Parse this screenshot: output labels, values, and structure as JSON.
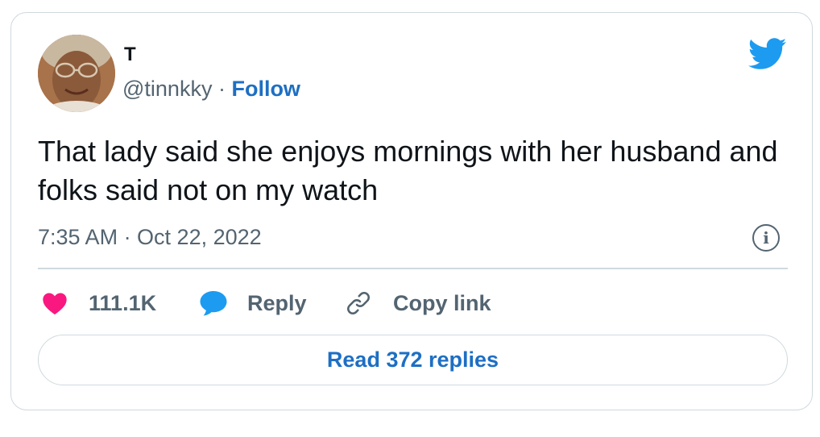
{
  "tweet": {
    "author_name": "T",
    "handle": "@tinnkky",
    "separator": " · ",
    "follow_label": "Follow",
    "text": "That lady said she enjoys mornings with her husband and folks said not on my watch",
    "timestamp": "7:35 AM · Oct 22, 2022",
    "info_glyph": "i"
  },
  "actions": {
    "likes_count": "111.1K",
    "reply_label": "Reply",
    "copy_link_label": "Copy link",
    "read_replies_label": "Read 372 replies"
  },
  "icons": {
    "brand": "twitter-bird-icon",
    "like": "heart-icon",
    "reply": "speech-bubble-icon",
    "copy": "link-icon",
    "info": "info-icon"
  },
  "colors": {
    "twitter_blue": "#1d9bf0",
    "link_blue": "#1d6fc3",
    "heart_pink": "#f91880",
    "muted_text": "#536471",
    "border": "#cfd9de"
  }
}
